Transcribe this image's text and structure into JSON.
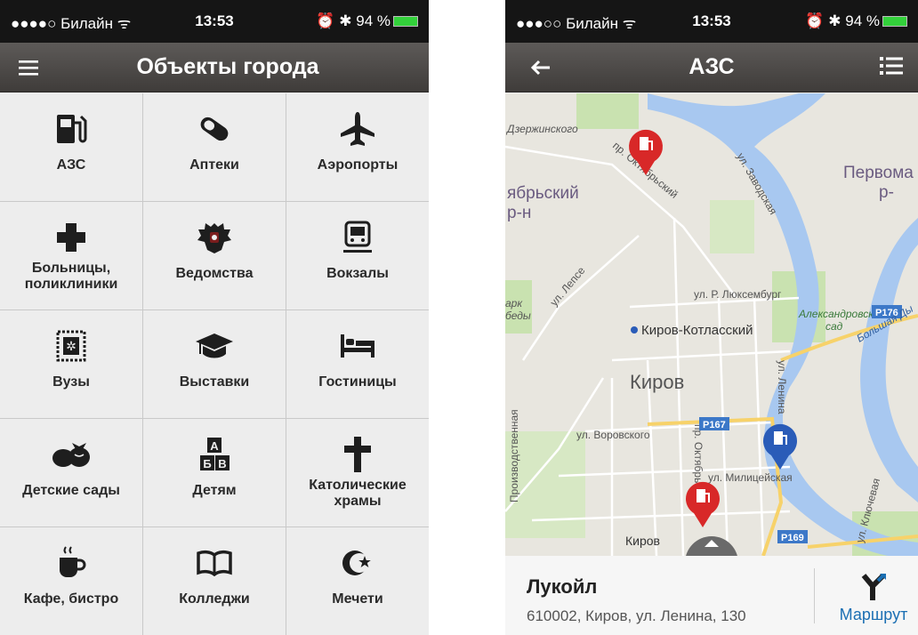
{
  "left_screen": {
    "status": {
      "carrier": "●●●●○ Билайн ᯤ",
      "time": "13:53",
      "right": "⏰ ✱ 94 %"
    },
    "nav": {
      "title": "Объекты города",
      "menu_icon": "hamburger-icon"
    },
    "categories": [
      {
        "label": "АЗС",
        "icon": "fuel-icon"
      },
      {
        "label": "Аптеки",
        "icon": "pill-icon"
      },
      {
        "label": "Аэропорты",
        "icon": "airplane-icon"
      },
      {
        "label": "Больницы, поликлиники",
        "icon": "medical-cross-icon"
      },
      {
        "label": "Ведомства",
        "icon": "emblem-icon"
      },
      {
        "label": "Вокзалы",
        "icon": "train-icon"
      },
      {
        "label": "Вузы",
        "icon": "diploma-icon"
      },
      {
        "label": "Выставки",
        "icon": "graduation-cap-icon"
      },
      {
        "label": "Гостиницы",
        "icon": "bed-icon"
      },
      {
        "label": "Детские сады",
        "icon": "bow-icon"
      },
      {
        "label": "Детям",
        "icon": "abc-blocks-icon"
      },
      {
        "label": "Католические храмы",
        "icon": "cross-icon"
      },
      {
        "label": "Кафе, бистро",
        "icon": "coffee-icon"
      },
      {
        "label": "Колледжи",
        "icon": "book-icon"
      },
      {
        "label": "Мечети",
        "icon": "crescent-star-icon"
      }
    ],
    "blocks": {
      "a": "А",
      "b": "Б",
      "v": "В"
    }
  },
  "right_screen": {
    "status": {
      "carrier": "●●●○○ Билайн ᯤ",
      "time": "13:53",
      "right": "⏰ ✱ 94 %"
    },
    "nav": {
      "title": "АЗС",
      "back_icon": "back-arrow-icon",
      "list_icon": "list-icon"
    },
    "map": {
      "labels": {
        "dzerzhinskogo": "Дзержинского",
        "oktyabrsky_district": "ябрьский р-н",
        "pr_oktyabrsky_top": "пр. Октябрьский",
        "zavodskaya": "ул. Заводская",
        "pervomaisky": "Первома р-",
        "r176": "Р176",
        "bolshaya": "Большая Ды",
        "lepse": "ул. Лепсе",
        "luxemburg": "ул. Р. Люксембург",
        "park": "арк беды",
        "station": "Киров-Котласский",
        "alexandrovsky": "Александровский сад",
        "lenina": "ул. Ленина",
        "kirov": "Киров",
        "proizvodstvennaya": "Производственная",
        "vorovskogo": "ул. Воровского",
        "r167": "Р167",
        "pr_oktyabrsky_bottom": "пр. Октябрьский",
        "militseyskaya": "ул. Милицейская",
        "klyuchevaya": "ул. Ключевая",
        "kirov_bottom": "Киров",
        "r169": "Р169"
      }
    },
    "place": {
      "name": "Лукойл",
      "address": "610002, Киров, ул. Ленина, 130",
      "route_label": "Маршрут",
      "route_icon": "route-icon"
    }
  },
  "colors": {
    "navbar": "#4f4c4a",
    "grid_line": "#c9c9c9",
    "tile": "#ededed",
    "accent_blue": "#1b6fb3",
    "pin_red": "#d82828",
    "pin_blue": "#2a5cb8",
    "water": "#a8c8f0",
    "park": "#c9e2b0",
    "road_yellow": "#f7d26a"
  }
}
